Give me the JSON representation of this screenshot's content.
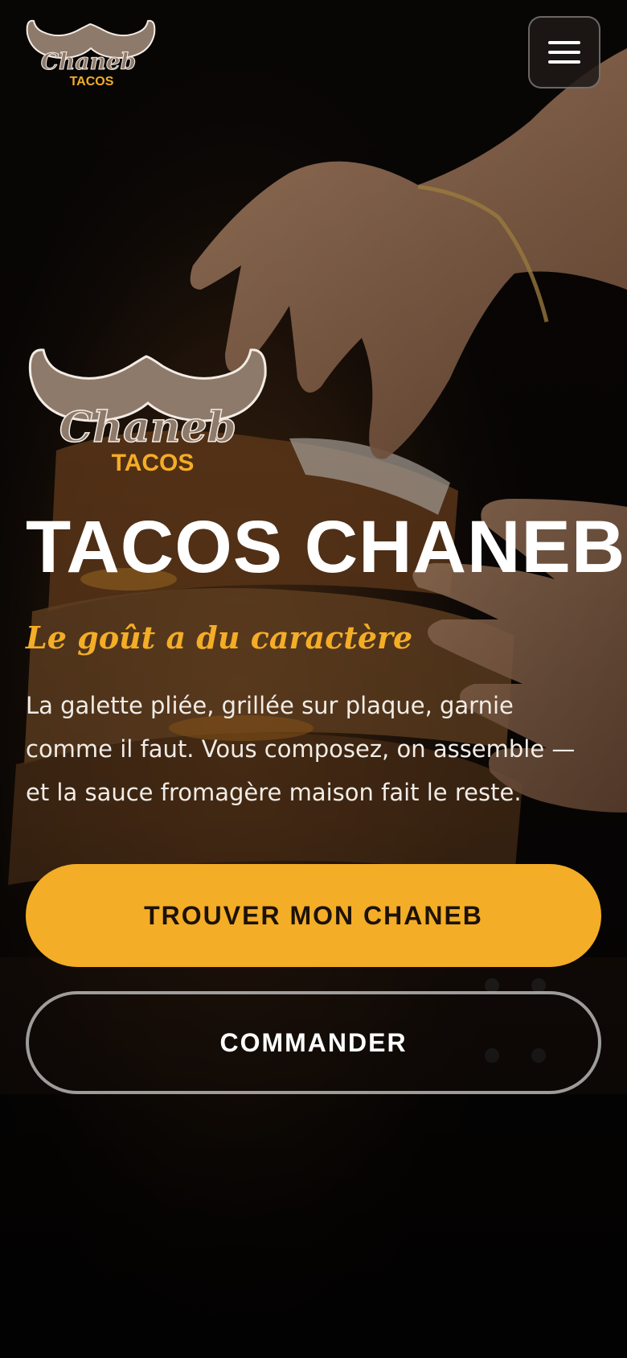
{
  "header": {
    "logo_word": "Chaneb",
    "logo_sub": "TACOS",
    "menu_icon": "hamburger-menu-icon"
  },
  "hero": {
    "logo_word": "Chaneb",
    "logo_sub": "TACOS",
    "title": "TACOS CHANEB",
    "tagline": "Le goût a du caractère",
    "description": "La galette pliée, grillée sur plaque, garnie comme il faut. Vous composez, on assemble — et la sauce fromagère maison fait le reste."
  },
  "actions": {
    "primary_label": "TROUVER MON CHANEB",
    "secondary_label": "COMMANDER"
  },
  "colors": {
    "accent": "#f4ad26",
    "mustache": "#8e7a6b",
    "background": "#0a0706",
    "text": "#ffffff"
  }
}
